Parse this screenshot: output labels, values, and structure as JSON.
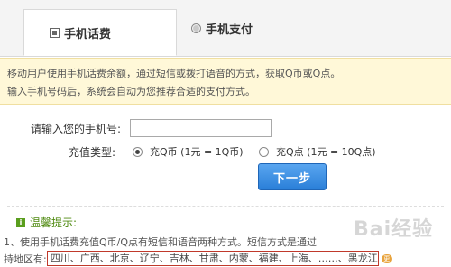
{
  "tabs": [
    {
      "label": "手机话费",
      "active": true
    },
    {
      "label": "手机支付",
      "active": false
    }
  ],
  "notice": {
    "line1": "移动用户使用手机话费余额，通过短信或拨打语音的方式，获取Q币或Q点。",
    "line2": "输入手机号码后，系统会自动为您推荐合适的支付方式。"
  },
  "form": {
    "phone_label": "请输入您的手机号:",
    "phone_value": "",
    "type_label": "充值类型:",
    "options": [
      {
        "label": "充Q币 (1元 = 1Q币)",
        "selected": true
      },
      {
        "label": "充Q点 (1元 = 10Q点)",
        "selected": false
      }
    ],
    "next_label": "下一步"
  },
  "tips": {
    "title": "温馨提示:",
    "line1": "1、使用手机话费充值Q币/Q点有短信和语音两种方式。短信方式是通过",
    "regions_prefix": "持地区有:",
    "regions": "四川、广西、北京、辽宁、吉林、甘肃、内蒙、福建、上海、……、黑龙江",
    "more_badge": "更"
  },
  "watermark": "Bai经验"
}
